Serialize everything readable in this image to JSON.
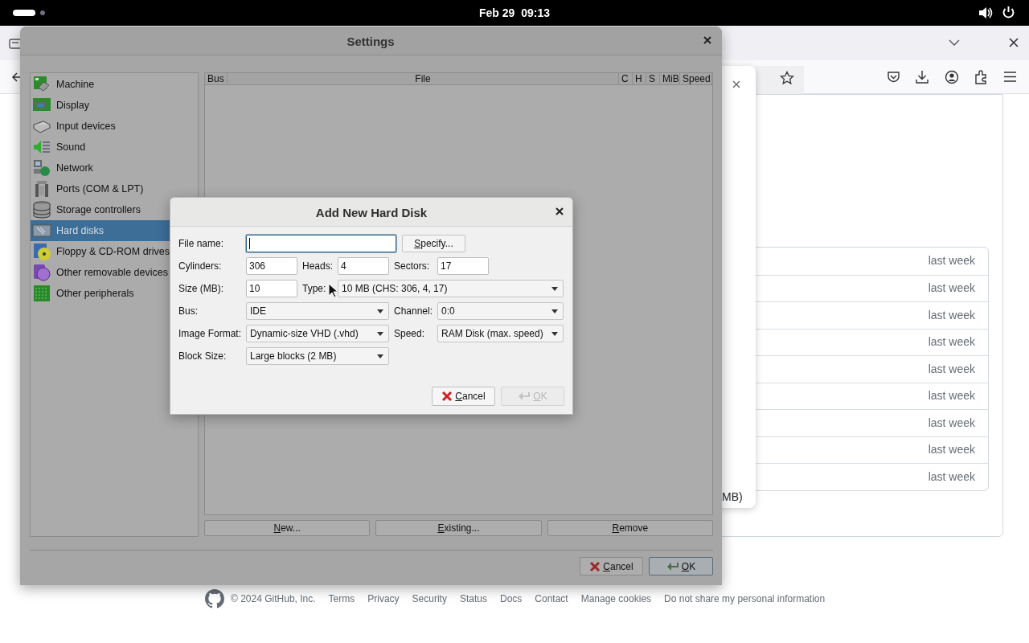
{
  "top_bar": {
    "clock": "Feb 29  09:13"
  },
  "browser": {
    "popup": {
      "text": "MB)"
    },
    "list_rows": [
      {
        "time": "last week"
      },
      {
        "time": "last week"
      },
      {
        "time": "last week"
      },
      {
        "time": "last week"
      },
      {
        "time": "last week"
      },
      {
        "time": "last week"
      },
      {
        "time": "last week"
      },
      {
        "time": "last week"
      },
      {
        "time": "last week"
      }
    ],
    "footer": {
      "copyright": "© 2024 GitHub, Inc.",
      "links": [
        "Terms",
        "Privacy",
        "Security",
        "Status",
        "Docs",
        "Contact",
        "Manage cookies",
        "Do not share my personal information"
      ]
    }
  },
  "settings": {
    "title": "Settings",
    "categories": [
      {
        "label": "Machine",
        "selected": false
      },
      {
        "label": "Display",
        "selected": false
      },
      {
        "label": "Input devices",
        "selected": false
      },
      {
        "label": "Sound",
        "selected": false
      },
      {
        "label": "Network",
        "selected": false
      },
      {
        "label": "Ports (COM & LPT)",
        "selected": false
      },
      {
        "label": "Storage controllers",
        "selected": false
      },
      {
        "label": "Hard disks",
        "selected": true
      },
      {
        "label": "Floppy & CD-ROM drives",
        "selected": false
      },
      {
        "label": "Other removable devices",
        "selected": false
      },
      {
        "label": "Other peripherals",
        "selected": false
      }
    ],
    "table": {
      "columns": [
        "Bus",
        "File",
        "C",
        "H",
        "S",
        "MiB",
        "Speed"
      ]
    },
    "disk_buttons": [
      "New...",
      "Existing...",
      "Remove"
    ],
    "buttons": [
      {
        "label": "Cancel",
        "kind": "cancel"
      },
      {
        "label": "OK",
        "kind": "ok"
      }
    ]
  },
  "dialog": {
    "title": "Add New Hard Disk",
    "fields": [
      {
        "label": "File name:",
        "kind": "text",
        "focused": true
      },
      {
        "label": "Cylinders:",
        "kind": "text",
        "value": "306",
        "focused": false
      },
      {
        "label": "Heads:",
        "kind": "text",
        "value": "4",
        "focused": false
      },
      {
        "label": "Sectors:",
        "kind": "text",
        "value": "17",
        "focused": false
      },
      {
        "label": "Size (MB):",
        "kind": "text",
        "value": "10",
        "focused": false
      },
      {
        "label": "Type:",
        "kind": "select",
        "value": "10 MB (CHS: 306, 4, 17)"
      },
      {
        "label": "Bus:",
        "kind": "select",
        "value": "IDE"
      },
      {
        "label": "Channel:",
        "kind": "select",
        "value": "0:0"
      },
      {
        "label": "Image Format:",
        "kind": "select",
        "value": "Dynamic-size VHD (.vhd)"
      },
      {
        "label": "Speed:",
        "kind": "select",
        "value": "RAM Disk (max. speed)"
      },
      {
        "label": "Block Size:",
        "kind": "select",
        "value": "Large blocks (2 MB)"
      }
    ],
    "specify_button": "Specify...",
    "buttons": [
      {
        "label": "Cancel",
        "kind": "cancel",
        "disabled": false
      },
      {
        "label": "OK",
        "kind": "ok",
        "disabled": true
      }
    ]
  }
}
